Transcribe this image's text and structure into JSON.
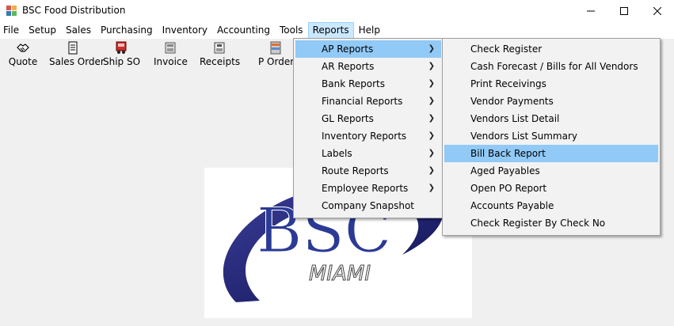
{
  "window": {
    "title": "BSC Food Distribution",
    "controls": [
      "minimize",
      "maximize",
      "close"
    ]
  },
  "menubar": {
    "items": [
      "File",
      "Setup",
      "Sales",
      "Purchasing",
      "Inventory",
      "Accounting",
      "Tools",
      "Reports",
      "Help"
    ],
    "active": "Reports"
  },
  "toolbar": {
    "buttons": [
      {
        "label": "Quote",
        "icon": "handshake-icon"
      },
      {
        "label": "Sales Order",
        "icon": "sales-order-icon"
      },
      {
        "label": "Ship SO",
        "icon": "truck-icon"
      },
      {
        "label": "Invoice",
        "icon": "invoice-icon"
      },
      {
        "label": "Receipts",
        "icon": "receipts-icon"
      },
      {
        "label": "P Order",
        "icon": "purchase-order-icon"
      }
    ]
  },
  "reports_menu": {
    "items": [
      {
        "label": "AP Reports",
        "submenu": true,
        "highlighted": true
      },
      {
        "label": "AR Reports",
        "submenu": true
      },
      {
        "label": "Bank Reports",
        "submenu": true
      },
      {
        "label": "Financial Reports",
        "submenu": true
      },
      {
        "label": "GL Reports",
        "submenu": true
      },
      {
        "label": "Inventory Reports",
        "submenu": true
      },
      {
        "label": "Labels",
        "submenu": true
      },
      {
        "label": "Route Reports",
        "submenu": true
      },
      {
        "label": "Employee Reports",
        "submenu": true
      },
      {
        "label": "Company Snapshot",
        "submenu": false
      }
    ]
  },
  "ap_reports_menu": {
    "items": [
      {
        "label": "Check Register"
      },
      {
        "label": "Cash Forecast / Bills for All Vendors"
      },
      {
        "label": "Print Receivings"
      },
      {
        "label": "Vendor Payments"
      },
      {
        "label": "Vendors List Detail"
      },
      {
        "label": "Vendors List Summary"
      },
      {
        "label": "Bill Back Report",
        "highlighted": true
      },
      {
        "label": "Aged Payables"
      },
      {
        "label": "Open PO Report"
      },
      {
        "label": "Accounts Payable"
      },
      {
        "label": "Check Register By Check No"
      }
    ]
  },
  "logo": {
    "text": "BSC",
    "subtext": "MIAMI",
    "colors": {
      "ring": "#1f1f6e",
      "text": "#2a3b8f"
    }
  },
  "colors": {
    "menu_active": "#cce8ff",
    "item_highlight": "#91c9f7",
    "dropdown_bg": "#f2f2f2",
    "window_bg": "#f0f0f0"
  }
}
